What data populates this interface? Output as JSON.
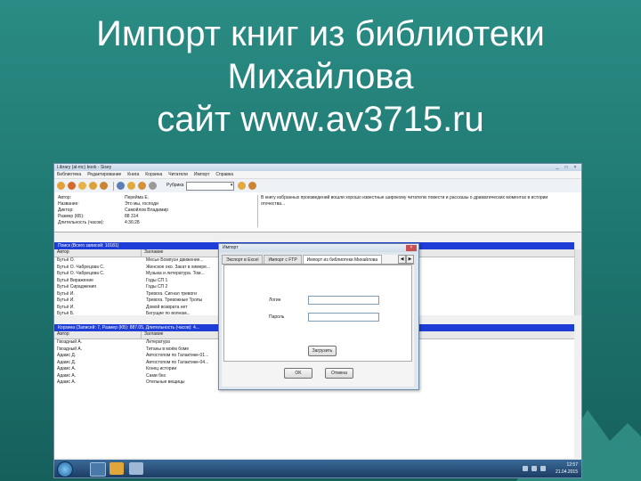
{
  "slide": {
    "title_lines": [
      "Импорт книг из библиотеки",
      "Михайлова",
      "сайт www.av3715.ru"
    ]
  },
  "window": {
    "title": "Library (al-mc) book - Sisey",
    "controls": [
      "_",
      "□",
      "×"
    ]
  },
  "menu": [
    "Библиотека",
    "Редактирование",
    "Книга",
    "Корзина",
    "Читатели",
    "Импорт",
    "Справка"
  ],
  "toolbar": {
    "rubric_label": "Рубрика",
    "rubric_value": ""
  },
  "info": {
    "rows": [
      {
        "key": "Автор:",
        "value": "Перейма Е."
      },
      {
        "key": "Название:",
        "value": "Это мы, господи"
      },
      {
        "key": "Диктор:",
        "value": "Самойлов Владимир"
      },
      {
        "key": "Размер (КБ):",
        "value": "88 314"
      },
      {
        "key": "Длительность (часов):",
        "value": "4:36:28"
      }
    ],
    "description": "В книгу избранных произведений вошли хорошо известные широкому читателю повести и рассказы о драматических моментах в истории отечества..."
  },
  "search_panel": {
    "header": "Поиск (Всего записей: 10181)",
    "columns": [
      "Автор",
      "Заглавие"
    ],
    "rows": [
      {
        "author": "Бутьё О.",
        "title": "Месье Бомпуэн движение..."
      },
      {
        "author": "Бутьё О. Чабрецова С.",
        "title": "Женское око. Закат в химере..."
      },
      {
        "author": "Бутьё О. Чабрецова С.",
        "title": "Музыка и литература. Том..."
      },
      {
        "author": "Бутьё Виражение",
        "title": "Годы СП 1"
      },
      {
        "author": "Бутьё Сираджения",
        "title": "Годы СП 2"
      },
      {
        "author": "Бутьё И.",
        "title": "Тревога. Сигнал тревоги"
      },
      {
        "author": "Бутьё И.",
        "title": "Тревога. Тревожные Тропы"
      },
      {
        "author": "Бутьё И.",
        "title": "Домой возврата нет"
      },
      {
        "author": "Бутьё Б.",
        "title": "Бегущие по волнам..."
      }
    ]
  },
  "basket_panel": {
    "header": "Корзина (Записей: 7, Размер (КБ): 887.05, Длительность (часов): 4...",
    "columns": [
      "Автор",
      "Заглавие"
    ],
    "rows": [
      {
        "author": "Гвоздный А.",
        "title": "Литература"
      },
      {
        "author": "Гвоздный А.",
        "title": "Титаны в моём боме"
      },
      {
        "author": "Адамс Д.",
        "title": "Автостопом по Галактике-01..."
      },
      {
        "author": "Адамс Д.",
        "title": "Автостопом по Галактике-04..."
      },
      {
        "author": "Адамс А.",
        "title": "Конец истории"
      },
      {
        "author": "Адамс А.",
        "title": "Сами без"
      },
      {
        "author": "Адамс А.",
        "title": "Отельные вещицы"
      }
    ]
  },
  "dialog": {
    "title": "Импорт",
    "close": "×",
    "tabs": [
      "Экспорт в Excel",
      "Импорт с FTP",
      "Импорт из библиотеки Михайлова"
    ],
    "active_tab": 2,
    "tab_arrows": [
      "◀",
      "▶"
    ],
    "login_label": "Логин",
    "password_label": "Пароль",
    "login_value": "",
    "password_value": "",
    "action_button": "Загрузить",
    "ok_button": "OK",
    "cancel_button": "Отмена"
  },
  "taskbar": {
    "time": "12:57",
    "date": "21.04.2015"
  },
  "colors": {
    "slide_bg": "#1f7872",
    "panel_header": "#1e3cd6",
    "taskbar": "#1d3d64"
  }
}
